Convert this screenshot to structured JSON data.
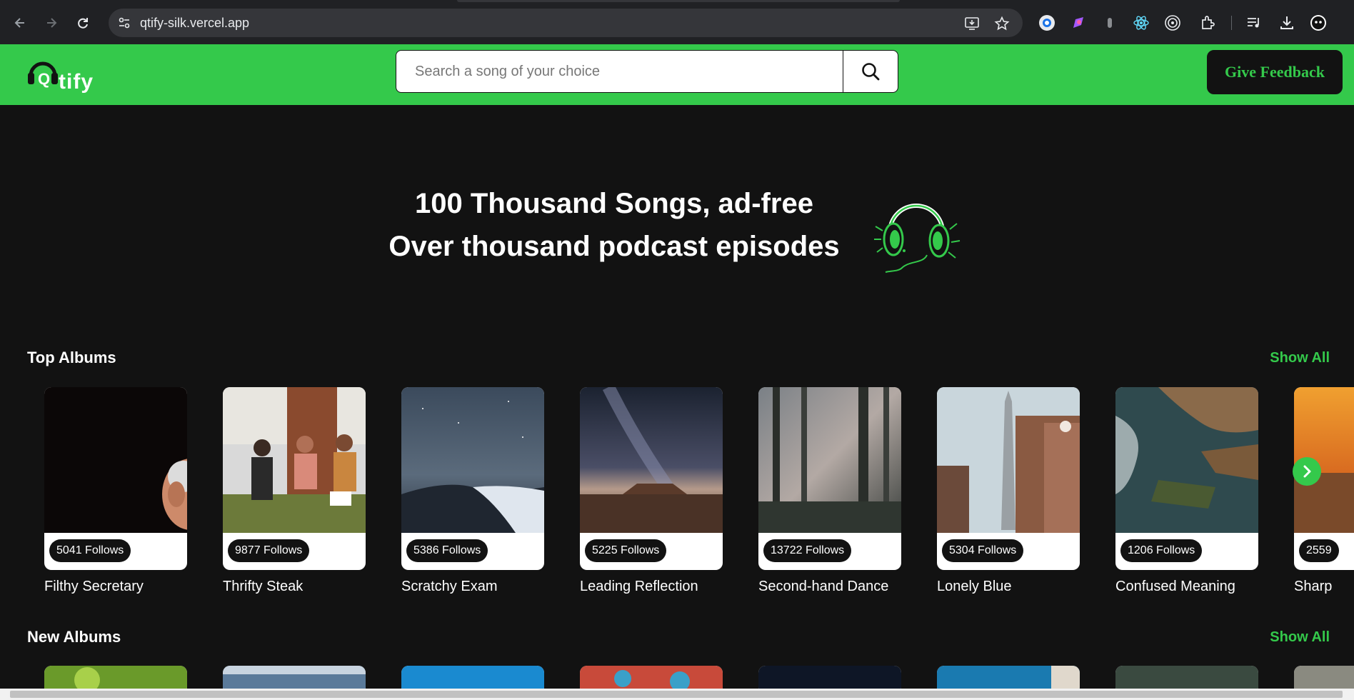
{
  "browser": {
    "url": "qtify-silk.vercel.app"
  },
  "header": {
    "logo_text": "tify",
    "logo_letter": "Q",
    "search_placeholder": "Search a song of your choice",
    "feedback_label": "Give Feedback",
    "accent_color": "#34c94b"
  },
  "hero": {
    "line1": "100 Thousand Songs, ad-free",
    "line2": "Over thousand podcast episodes"
  },
  "top_albums": {
    "title": "Top Albums",
    "show_all": "Show All",
    "items": [
      {
        "title": "Filthy Secretary",
        "follows": "5041 Follows"
      },
      {
        "title": "Thrifty Steak",
        "follows": "9877 Follows"
      },
      {
        "title": "Scratchy Exam",
        "follows": "5386 Follows"
      },
      {
        "title": "Leading Reflection",
        "follows": "5225 Follows"
      },
      {
        "title": "Second-hand Dance",
        "follows": "13722 Follows"
      },
      {
        "title": "Lonely Blue",
        "follows": "5304 Follows"
      },
      {
        "title": "Confused Meaning",
        "follows": "1206 Follows"
      },
      {
        "title": "Sharp",
        "follows": "2559"
      }
    ]
  },
  "new_albums": {
    "title": "New Albums",
    "show_all": "Show All"
  }
}
